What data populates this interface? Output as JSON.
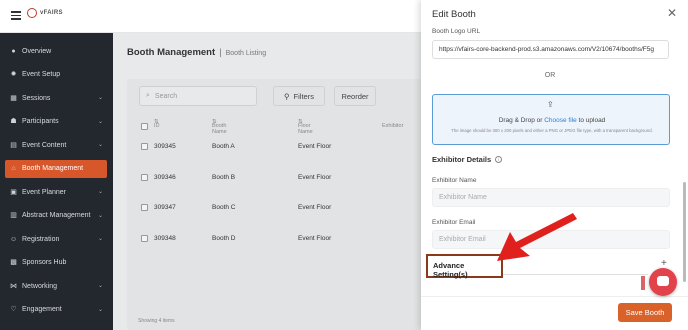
{
  "app": {
    "logo_text": "vFAIRS"
  },
  "sidebar": {
    "items": [
      {
        "label": "Overview",
        "icon": "overview-icon",
        "has_chevron": false
      },
      {
        "label": "Event Setup",
        "icon": "gear-icon",
        "has_chevron": false
      },
      {
        "label": "Sessions",
        "icon": "sessions-icon",
        "has_chevron": true
      },
      {
        "label": "Participants",
        "icon": "participants-icon",
        "has_chevron": true
      },
      {
        "label": "Event Content",
        "icon": "content-icon",
        "has_chevron": true
      },
      {
        "label": "Booth Management",
        "icon": "booth-icon",
        "has_chevron": false,
        "active": true
      },
      {
        "label": "Event Planner",
        "icon": "planner-icon",
        "has_chevron": true
      },
      {
        "label": "Abstract Management",
        "icon": "abstract-icon",
        "has_chevron": true
      },
      {
        "label": "Registration",
        "icon": "registration-icon",
        "has_chevron": true
      },
      {
        "label": "Sponsors Hub",
        "icon": "sponsors-icon",
        "has_chevron": false
      },
      {
        "label": "Networking",
        "icon": "networking-icon",
        "has_chevron": true
      },
      {
        "label": "Engagement",
        "icon": "engagement-icon",
        "has_chevron": true
      }
    ]
  },
  "main": {
    "title": "Booth Management",
    "subtitle": "Booth Listing",
    "search_placeholder": "Search",
    "filters_label": "Filters",
    "reorder_label": "Reorder",
    "columns": [
      "ID",
      "Booth Name",
      "Floor Name",
      "Exhibitor"
    ],
    "rows": [
      {
        "id": "309345",
        "name": "Booth A",
        "floor": "Event Floor"
      },
      {
        "id": "309346",
        "name": "Booth B",
        "floor": "Event Floor"
      },
      {
        "id": "309347",
        "name": "Booth C",
        "floor": "Event Floor"
      },
      {
        "id": "309348",
        "name": "Booth D",
        "floor": "Event Floor"
      }
    ],
    "footer": "Showing 4 items"
  },
  "drawer": {
    "title": "Edit Booth",
    "logo_url_label": "Booth Logo URL",
    "logo_url_value": "https://vfairs-core-backend-prod.s3.amazonaws.com/V2/10674/booths/F5g",
    "or_text": "OR",
    "upload_text_before": "Drag & Drop or ",
    "upload_link": "Choose file",
    "upload_text_after": " to upload",
    "upload_hint": "The image should be 300 x 200 pixels and either a PNG or JPEG file type, with a transparent background.",
    "exhibitor_section": "Exhibitor Details",
    "exhibitor_name_label": "Exhibitor Name",
    "exhibitor_name_placeholder": "Exhibitor Name",
    "exhibitor_email_label": "Exhibitor Email",
    "exhibitor_email_placeholder": "Exhibitor Email",
    "advance_settings": "Advance Setting(s)",
    "save_label": "Save Booth"
  },
  "colors": {
    "sidebar_bg": "#23282f",
    "active_item": "#d8572a",
    "save_button": "#d9622b",
    "annotation_arrow": "#e0201c",
    "link": "#2a7fd4"
  }
}
